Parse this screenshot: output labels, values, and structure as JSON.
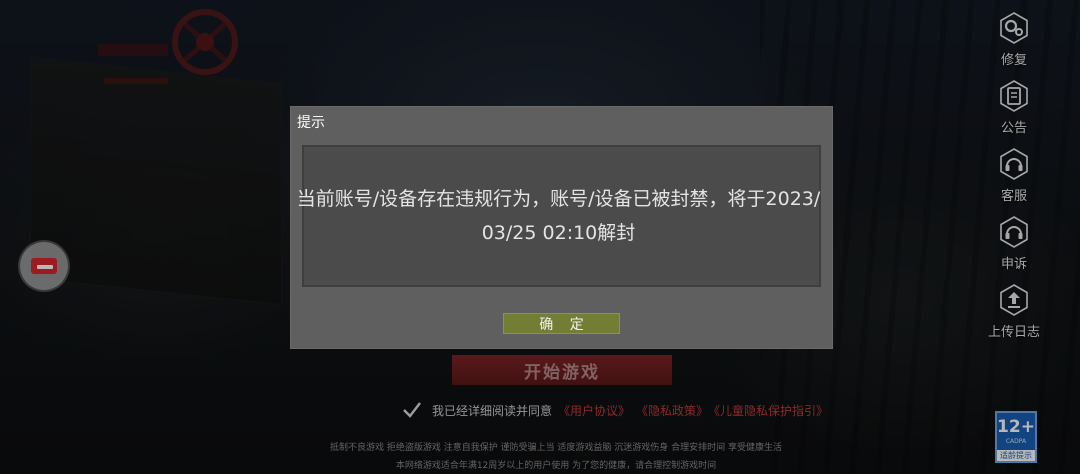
{
  "right_menu": [
    {
      "label": "修复",
      "icon": "gear-icon"
    },
    {
      "label": "公告",
      "icon": "notice-icon"
    },
    {
      "label": "客服",
      "icon": "headset-icon"
    },
    {
      "label": "申诉",
      "icon": "headset-icon"
    },
    {
      "label": "上传日志",
      "icon": "upload-icon"
    }
  ],
  "main": {
    "start_label": "开始游戏",
    "agree_text": "我已经详细阅读并同意",
    "links": [
      "《用户协议》",
      "《隐私政策》",
      "《儿童隐私保护指引》"
    ],
    "footer_line1": "抵制不良游戏  拒绝盗版游戏  注意自我保护  谨防受骗上当  适度游戏益脑  沉迷游戏伤身  合理安排时间  享受健康生活",
    "footer_line2": "本网络游戏适合年满12周岁以上的用户使用     为了您的健康，请合理控制游戏时间"
  },
  "age_badge": {
    "rating": "12+",
    "org": "CADPA",
    "tip": "适龄提示"
  },
  "dialog": {
    "title": "提示",
    "message": "当前账号/设备存在违规行为，账号/设备已被封禁，将于2023/03/25 02:10解封",
    "confirm_label": "确 定"
  },
  "colors": {
    "dialog_bg": "#5f5f5f",
    "dialog_body_bg": "#4b4b4b",
    "confirm_button": "#737d34",
    "link_red": "#c23a3a",
    "age_badge_blue": "#1a5fb4"
  }
}
